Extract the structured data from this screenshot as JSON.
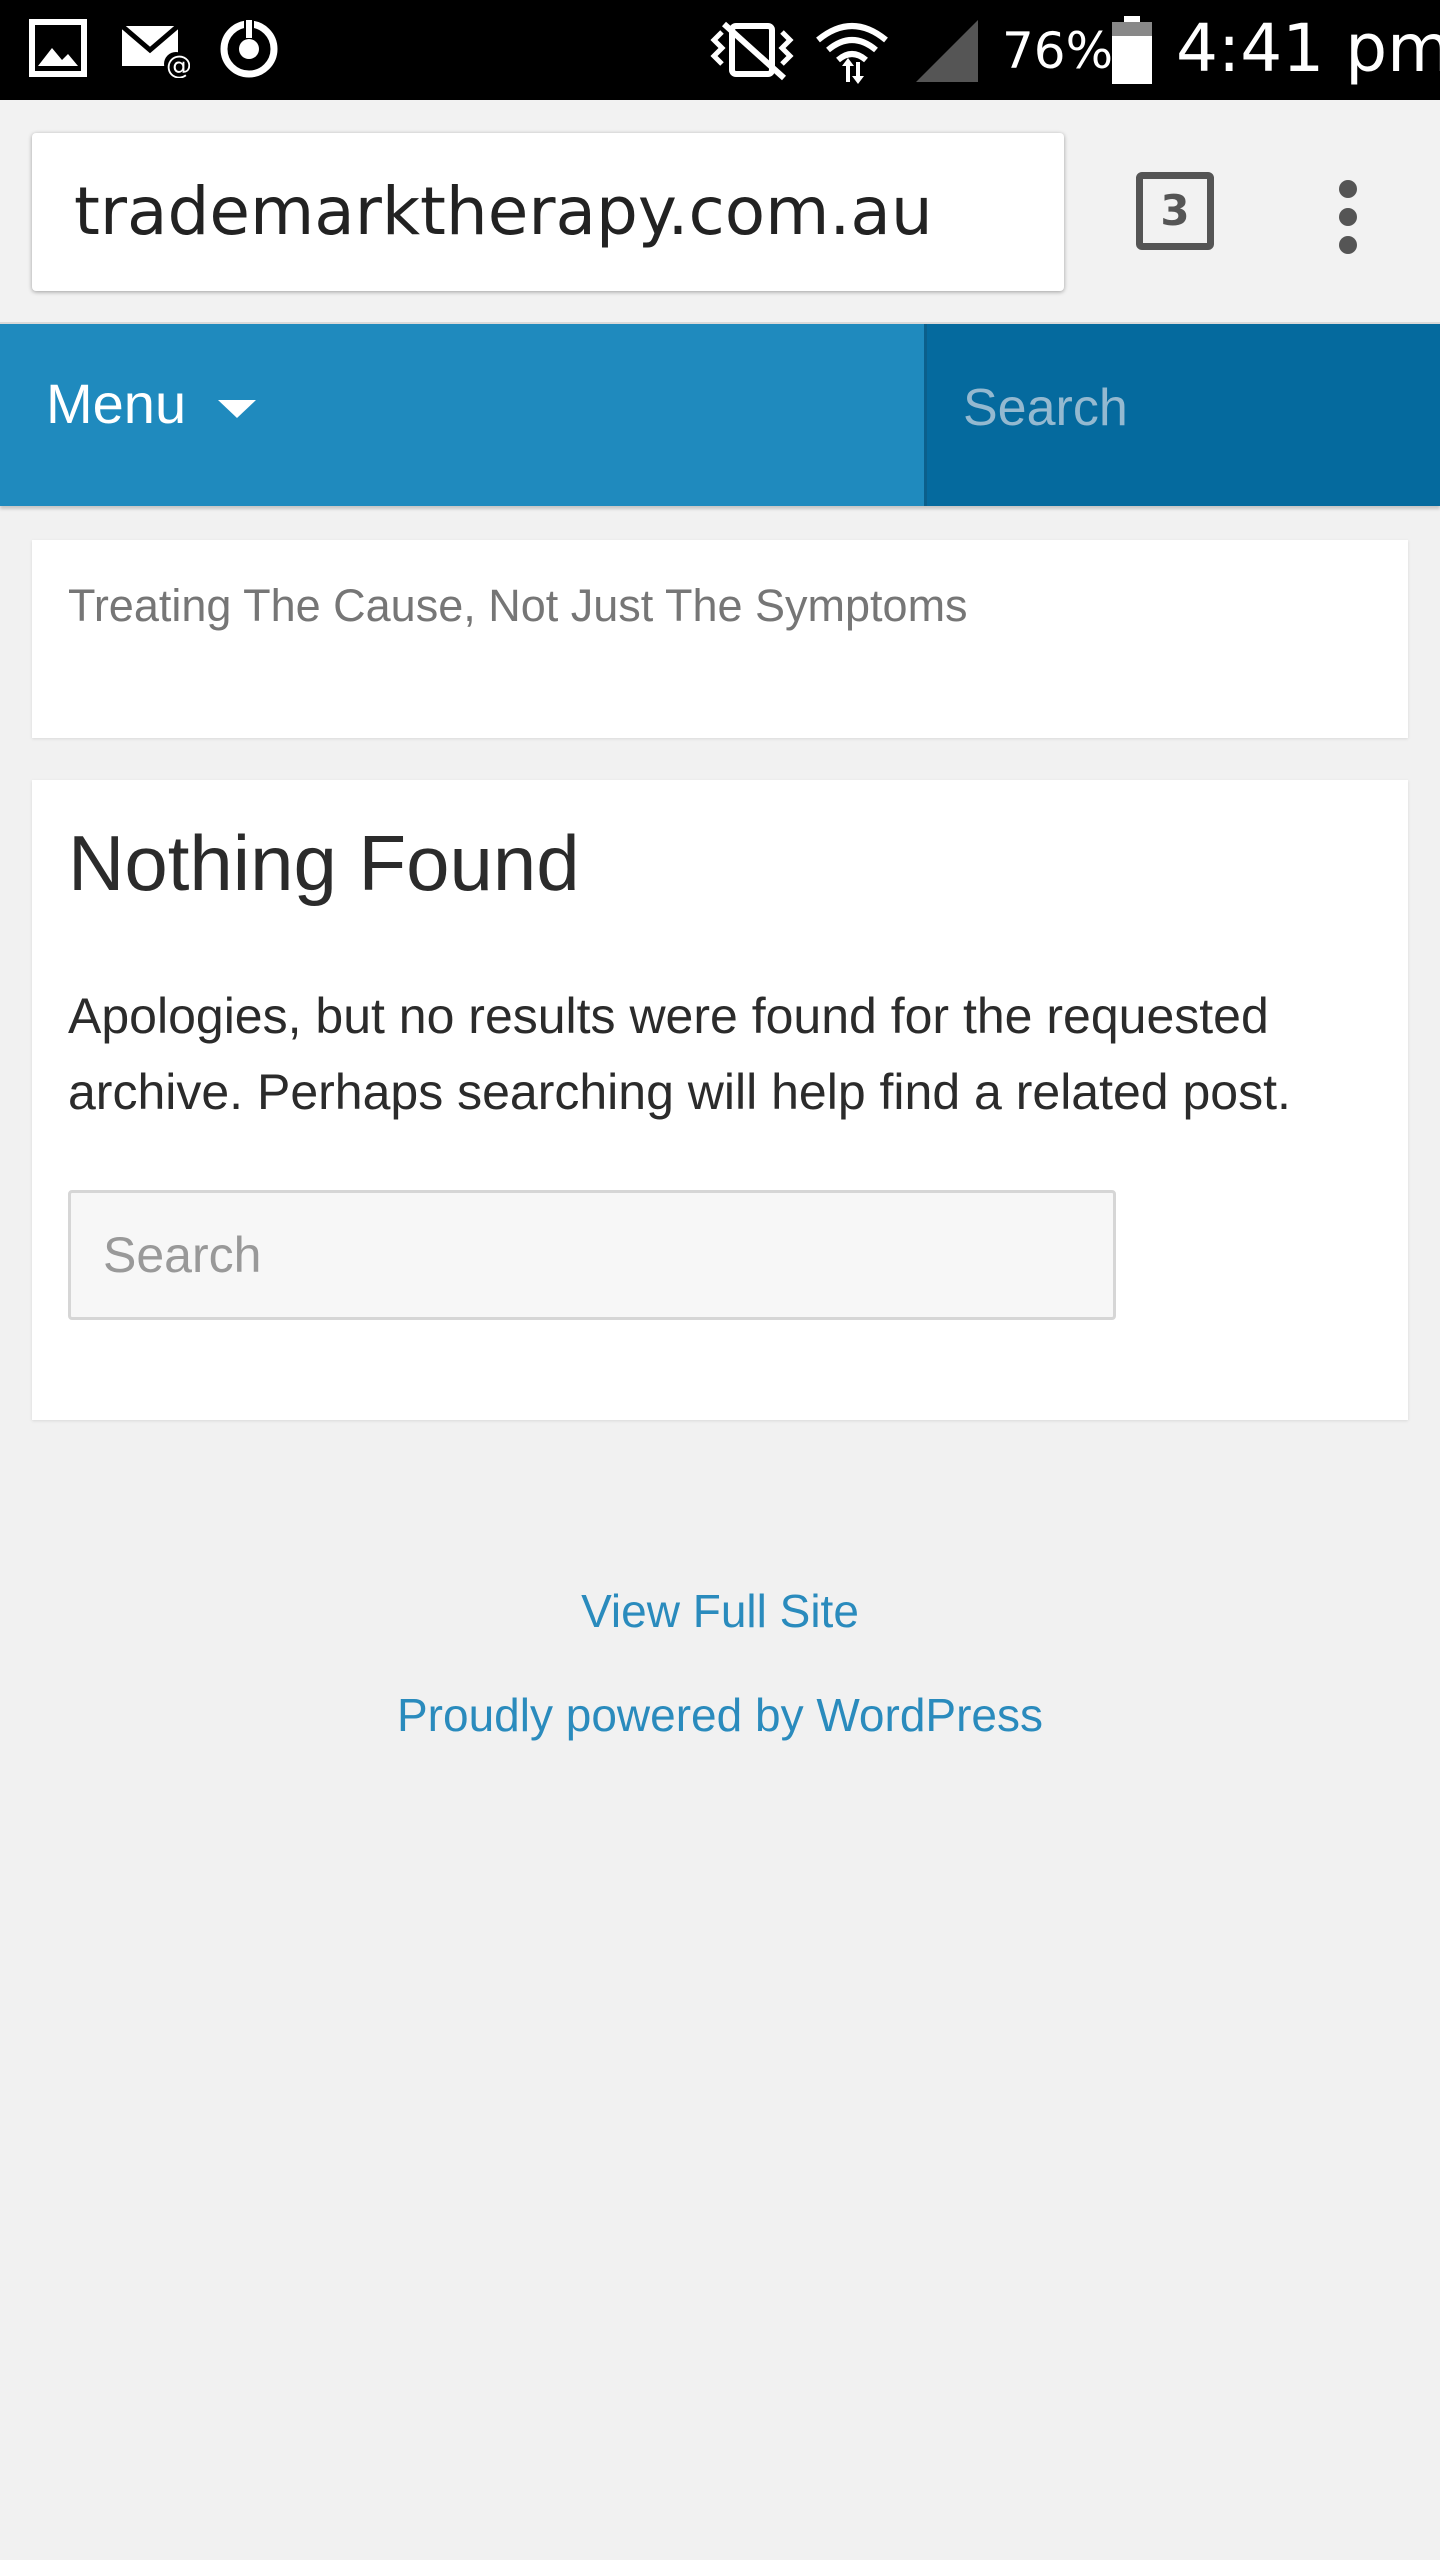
{
  "status_bar": {
    "battery_percent": "76%",
    "time": "4:41 pm",
    "icons": [
      "gallery-icon",
      "email-notification-icon",
      "sync-icon",
      "vibrate-mute-icon",
      "wifi-icon",
      "cell-signal-icon",
      "battery-icon"
    ]
  },
  "browser": {
    "url": "trademarktherapy.com.au",
    "tab_count": "3"
  },
  "nav": {
    "menu_label": "Menu",
    "search_placeholder": "Search",
    "bar_color": "#1f8abe",
    "search_color": "#056a9e"
  },
  "site": {
    "tagline": "Treating The Cause, Not Just The Symptoms"
  },
  "content": {
    "title": "Nothing Found",
    "message": "Apologies, but no results were found for the requested archive. Perhaps searching will help find a related post.",
    "search_placeholder": "Search"
  },
  "footer": {
    "view_full_site": "View Full Site",
    "powered_by": "Proudly powered by WordPress",
    "link_color": "#2a8bbd"
  }
}
